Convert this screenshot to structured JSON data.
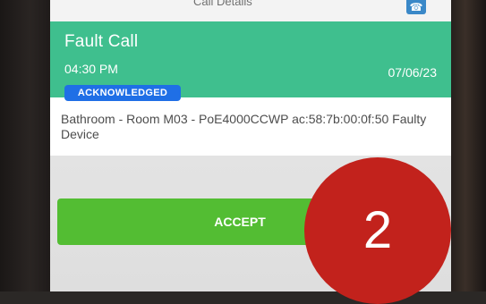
{
  "top_strip": {
    "title": "Call Details",
    "icon": "phone-icon"
  },
  "alert": {
    "title": "Fault Call",
    "time": "04:30 PM",
    "date": "07/06/23",
    "status": "ACKNOWLEDGED",
    "description": "Bathroom - Room M03 - PoE4000CCWP ac:58:7b:00:0f:50 Faulty Device"
  },
  "actions": {
    "accept_label": "ACCEPT"
  },
  "overlay": {
    "step_number": "2"
  },
  "colors": {
    "header_green": "#3fbf8e",
    "badge_blue": "#1f6fe6",
    "accept_green": "#53bd33",
    "overlay_red": "#c2221c"
  }
}
